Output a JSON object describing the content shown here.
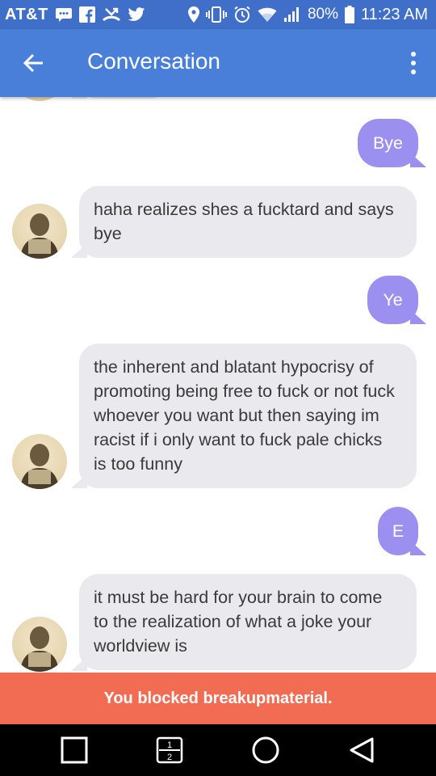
{
  "status_bar": {
    "carrier": "AT&T",
    "battery": "80%",
    "time": "11:23 AM",
    "icons_left": [
      "message-icon",
      "facebook-icon",
      "missed-call-icon",
      "twitter-icon"
    ],
    "icons_right": [
      "location-icon",
      "vibrate-icon",
      "alarm-icon",
      "wifi-icon",
      "signal-icon",
      "battery-icon"
    ]
  },
  "app_bar": {
    "title": "Conversation",
    "back_icon": "arrow-left-icon",
    "menu_icon": "more-vert-icon"
  },
  "messages": [
    {
      "direction": "out",
      "text": "Bye"
    },
    {
      "direction": "in",
      "text": "haha realizes shes a fucktard and says bye"
    },
    {
      "direction": "out",
      "text": "Ye"
    },
    {
      "direction": "in",
      "text": "the inherent and blatant hypocrisy of promoting being free to fuck or not fuck whoever you want but then saying im racist if i only want to fuck pale chicks is too funny"
    },
    {
      "direction": "out",
      "text": "E"
    },
    {
      "direction": "in",
      "text": "it must be hard for your brain to come to the realization of what a joke your worldview is"
    }
  ],
  "banner": {
    "text": "You blocked breakupmaterial."
  },
  "nav_bar": {
    "recents_icon": "square-icon",
    "dual_window_icon": "dual-window-icon",
    "dual_window_label_top": "1",
    "dual_window_label_bottom": "2",
    "home_icon": "circle-icon",
    "back_icon": "triangle-back-icon"
  },
  "colors": {
    "status_bar": "#3f6fc9",
    "app_bar": "#4a7fd9",
    "incoming_bubble": "#e9e9ee",
    "outgoing_bubble": "#9b8ff0",
    "banner": "#f26c53"
  }
}
